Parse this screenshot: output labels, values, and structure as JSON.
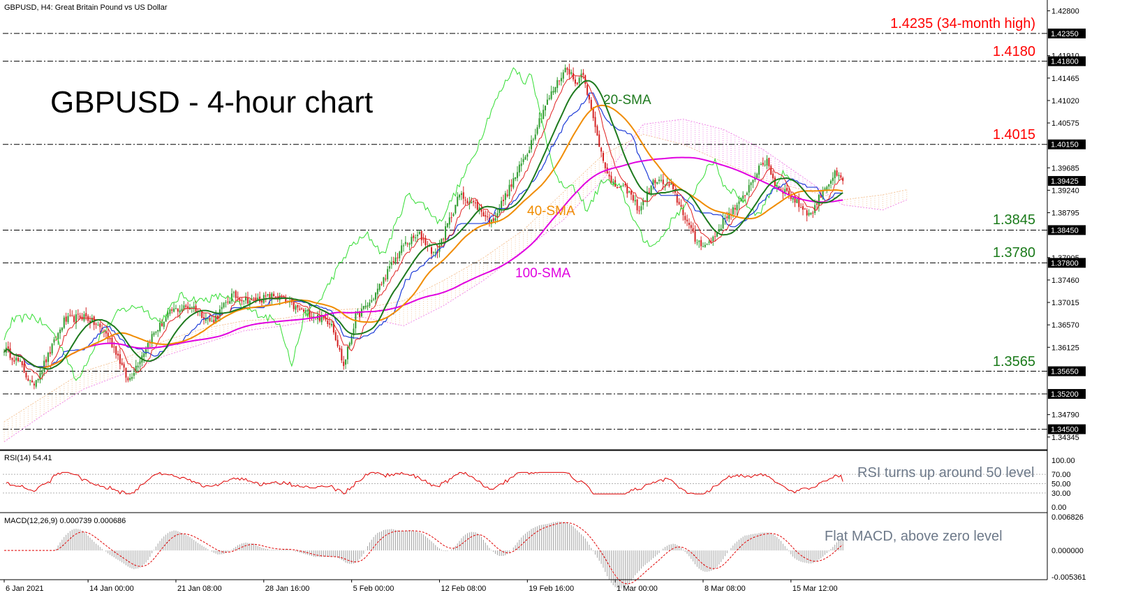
{
  "header": {
    "symbol_line": "GBPUSD, H4:  Great Britain Pound vs US Dollar",
    "rsi_line": "RSI(14) 54.41",
    "macd_line": "MACD(12,26,9) 0.000739 0.000686"
  },
  "title": "GBPUSD - 4-hour chart",
  "annotations": {
    "sma20": "20-SMA",
    "sma40": "40-SMA",
    "sma100": "100-SMA",
    "rsi_note": "RSI turns up around 50 level",
    "macd_note": "Flat MACD, above zero level"
  },
  "colors": {
    "bull_candle": "#2e9b2e",
    "bear_candle": "#d42020",
    "sma20": "#1e7a1e",
    "sma40": "#f08c00",
    "sma100": "#e000e0",
    "kijun": "#1e3cd8",
    "tenkan": "#e02020",
    "chikou": "#33dd33",
    "cloud_bull": "#f5c9a0",
    "cloud_bear": "#f08ae8",
    "resistance_label": "#ff0000",
    "support_label": "#1a7a1a",
    "rsi_line": "#e00000",
    "macd_signal": "#e00000",
    "macd_hist": "#a0a0a0"
  },
  "levels": [
    {
      "value": 1.4235,
      "label": "1.4235 (34-month high)",
      "type": "resistance",
      "axis_box": "1.42350"
    },
    {
      "value": 1.418,
      "label": "1.4180",
      "type": "resistance",
      "axis_box": "1.41800"
    },
    {
      "value": 1.4015,
      "label": "1.4015",
      "type": "resistance",
      "axis_box": "1.40150"
    },
    {
      "value": 1.3845,
      "label": "1.3845",
      "type": "support",
      "axis_box": "1.38450"
    },
    {
      "value": 1.378,
      "label": "1.3780",
      "type": "support",
      "axis_box": "1.37800"
    },
    {
      "value": 1.3565,
      "label": "1.3565",
      "type": "support",
      "axis_box": "1.35650"
    },
    {
      "value": 1.352,
      "label": "",
      "type": "plain",
      "axis_box": "1.35200"
    },
    {
      "value": 1.345,
      "label": "",
      "type": "plain",
      "axis_box": "1.34500"
    }
  ],
  "current_price_box": "1.39425",
  "chart_data": {
    "type": "candlestick",
    "title": "GBPUSD - 4-hour chart",
    "price_axis": {
      "ylim": [
        1.3412,
        1.4282
      ],
      "ticks": [
        "1.42800",
        "1.41910",
        "1.41465",
        "1.41020",
        "1.40575",
        "1.39685",
        "1.39240",
        "1.38795",
        "1.37905",
        "1.37460",
        "1.37015",
        "1.36570",
        "1.36125",
        "1.34790",
        "1.34345"
      ]
    },
    "time_axis": {
      "labels": [
        "6 Jan 2021",
        "14 Jan 00:00",
        "21 Jan 08:00",
        "28 Jan 16:00",
        "5 Feb 00:00",
        "12 Feb 08:00",
        "19 Feb 16:00",
        "1 Mar 00:00",
        "8 Mar 08:00",
        "15 Mar 12:00"
      ],
      "label_bars": [
        0,
        42,
        86,
        130,
        174,
        218,
        262,
        306,
        350,
        394
      ]
    },
    "price_anchors": [
      [
        0,
        1.361
      ],
      [
        8,
        1.358
      ],
      [
        14,
        1.3535
      ],
      [
        22,
        1.3595
      ],
      [
        30,
        1.3665
      ],
      [
        40,
        1.3675
      ],
      [
        50,
        1.3645
      ],
      [
        56,
        1.3605
      ],
      [
        62,
        1.3545
      ],
      [
        66,
        1.3575
      ],
      [
        74,
        1.3635
      ],
      [
        84,
        1.3685
      ],
      [
        94,
        1.3695
      ],
      [
        104,
        1.3662
      ],
      [
        114,
        1.3715
      ],
      [
        124,
        1.3705
      ],
      [
        136,
        1.3715
      ],
      [
        146,
        1.369
      ],
      [
        154,
        1.3678
      ],
      [
        164,
        1.3662
      ],
      [
        170,
        1.3575
      ],
      [
        176,
        1.3672
      ],
      [
        184,
        1.3705
      ],
      [
        192,
        1.3762
      ],
      [
        200,
        1.3815
      ],
      [
        208,
        1.3835
      ],
      [
        216,
        1.3795
      ],
      [
        222,
        1.3855
      ],
      [
        228,
        1.3915
      ],
      [
        236,
        1.3895
      ],
      [
        244,
        1.386
      ],
      [
        254,
        1.3935
      ],
      [
        262,
        1.4
      ],
      [
        270,
        1.4085
      ],
      [
        278,
        1.4145
      ],
      [
        282,
        1.417
      ],
      [
        286,
        1.4135
      ],
      [
        290,
        1.416
      ],
      [
        294,
        1.408
      ],
      [
        298,
        1.4015
      ],
      [
        304,
        1.3935
      ],
      [
        312,
        1.3925
      ],
      [
        318,
        1.3885
      ],
      [
        326,
        1.3945
      ],
      [
        334,
        1.393
      ],
      [
        340,
        1.388
      ],
      [
        346,
        1.3825
      ],
      [
        352,
        1.3815
      ],
      [
        356,
        1.3835
      ],
      [
        362,
        1.3875
      ],
      [
        368,
        1.3895
      ],
      [
        376,
        1.3955
      ],
      [
        382,
        1.3985
      ],
      [
        386,
        1.3935
      ],
      [
        392,
        1.392
      ],
      [
        398,
        1.3895
      ],
      [
        404,
        1.3875
      ],
      [
        410,
        1.3925
      ],
      [
        416,
        1.3955
      ],
      [
        420,
        1.3942
      ]
    ],
    "ichimoku": {
      "cloud_a_anchors": [
        [
          0,
          1.3465
        ],
        [
          20,
          1.3515
        ],
        [
          40,
          1.3565
        ],
        [
          60,
          1.359
        ],
        [
          80,
          1.3625
        ],
        [
          100,
          1.365
        ],
        [
          120,
          1.3665
        ],
        [
          140,
          1.367
        ],
        [
          160,
          1.3685
        ],
        [
          180,
          1.369
        ],
        [
          200,
          1.3705
        ],
        [
          220,
          1.3745
        ],
        [
          240,
          1.379
        ],
        [
          260,
          1.3845
        ],
        [
          280,
          1.392
        ],
        [
          300,
          1.3995
        ],
        [
          320,
          1.4035
        ],
        [
          340,
          1.4015
        ],
        [
          360,
          1.398
        ],
        [
          380,
          1.3945
        ],
        [
          400,
          1.3925
        ],
        [
          420,
          1.3905
        ],
        [
          440,
          1.3915
        ],
        [
          452,
          1.3925
        ]
      ],
      "cloud_b_anchors": [
        [
          0,
          1.3425
        ],
        [
          20,
          1.348
        ],
        [
          40,
          1.353
        ],
        [
          60,
          1.356
        ],
        [
          80,
          1.3595
        ],
        [
          100,
          1.362
        ],
        [
          120,
          1.3645
        ],
        [
          140,
          1.3655
        ],
        [
          160,
          1.367
        ],
        [
          180,
          1.3672
        ],
        [
          200,
          1.3655
        ],
        [
          220,
          1.3695
        ],
        [
          240,
          1.3745
        ],
        [
          260,
          1.3805
        ],
        [
          280,
          1.3865
        ],
        [
          300,
          1.3945
        ],
        [
          320,
          1.4055
        ],
        [
          340,
          1.4065
        ],
        [
          360,
          1.4045
        ],
        [
          380,
          1.4005
        ],
        [
          400,
          1.395
        ],
        [
          420,
          1.3895
        ],
        [
          440,
          1.3885
        ],
        [
          452,
          1.3905
        ]
      ]
    },
    "rsi": {
      "value": 54.41,
      "ylim": [
        0,
        100
      ],
      "levels": [
        30,
        50,
        70
      ],
      "ticks": [
        "100.00",
        "70.00",
        "50.00",
        "30.00",
        "0.00"
      ]
    },
    "macd": {
      "main": 0.000739,
      "signal": 0.000686,
      "ylim": [
        -0.005361,
        0.006826
      ],
      "ticks": [
        "0.006826",
        "0.000000",
        "-0.005361"
      ]
    }
  }
}
